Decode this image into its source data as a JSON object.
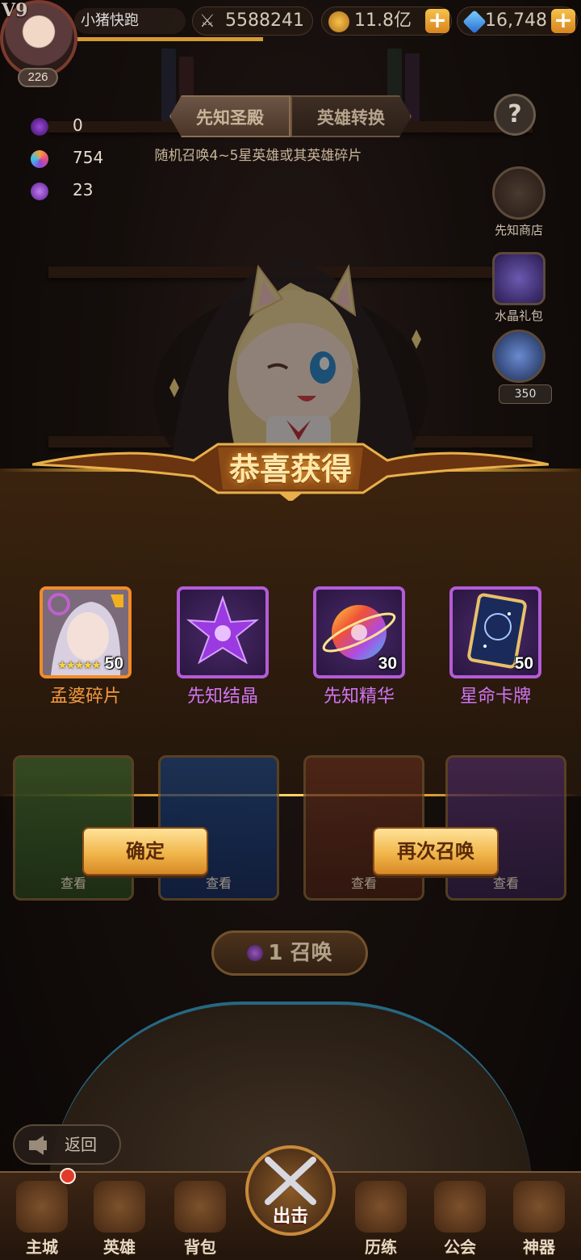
{
  "topbar": {
    "vip": "V9",
    "level": "226",
    "player_name": "小猪快跑",
    "power": "5588241",
    "gold": "11.8亿",
    "diamonds": "16,748",
    "plus": "+"
  },
  "resources": [
    {
      "value": "0",
      "color": "#6a2a9a"
    },
    {
      "value": "754",
      "color": "#e07a3a"
    },
    {
      "value": "23",
      "color": "#8a3ad0"
    }
  ],
  "tabs": {
    "active": "先知圣殿",
    "other": "英雄转换"
  },
  "subtitle": "随机召唤4~5星英雄或其英雄碎片",
  "side": {
    "help": "?",
    "shop": "先知商店",
    "gift": "水晶礼包",
    "orb_count": "350"
  },
  "banner_title": "恭喜获得",
  "rewards": [
    {
      "name": "孟婆碎片",
      "qty": "50",
      "style": "orange",
      "stars": "★★★★★"
    },
    {
      "name": "先知结晶",
      "qty": "",
      "style": "purple"
    },
    {
      "name": "先知精华",
      "qty": "30",
      "style": "purple"
    },
    {
      "name": "星命卡牌",
      "qty": "50",
      "style": "purple"
    }
  ],
  "cards": {
    "see": "查看"
  },
  "buttons": {
    "confirm": "确定",
    "again": "再次召唤"
  },
  "summon": {
    "label": "1 召唤"
  },
  "back": "返回",
  "nav": [
    {
      "label": "主城"
    },
    {
      "label": "英雄"
    },
    {
      "label": "背包"
    },
    {
      "label": "出击"
    },
    {
      "label": "历练"
    },
    {
      "label": "公会"
    },
    {
      "label": "神器"
    }
  ],
  "colors": {
    "accent": "#f1b64b",
    "purple_frame": "#b35cd8",
    "orange_frame": "#f18b2a"
  }
}
